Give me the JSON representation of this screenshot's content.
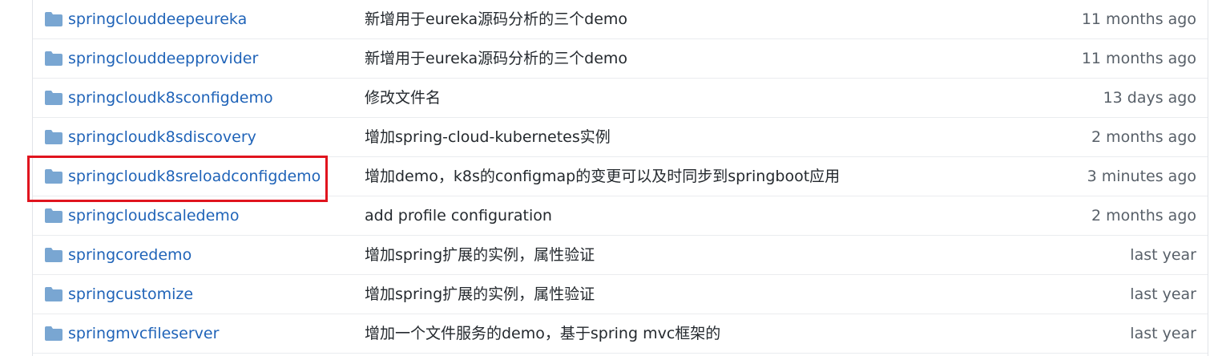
{
  "colors": {
    "link": "#1f63b8",
    "folder_icon": "#79a6d2",
    "highlight": "#e0141e",
    "age_text": "#586069"
  },
  "rows": [
    {
      "name": "springclouddeepeureka",
      "message": "新增用于eureka源码分析的三个demo",
      "age": "11 months ago",
      "icon": "folder-icon"
    },
    {
      "name": "springclouddeepprovider",
      "message": "新增用于eureka源码分析的三个demo",
      "age": "11 months ago",
      "icon": "folder-icon"
    },
    {
      "name": "springcloudk8sconfigdemo",
      "message": "修改文件名",
      "age": "13 days ago",
      "icon": "folder-icon"
    },
    {
      "name": "springcloudk8sdiscovery",
      "message": "增加spring-cloud-kubernetes实例",
      "age": "2 months ago",
      "icon": "folder-icon"
    },
    {
      "name": "springcloudk8sreloadconfigdemo",
      "message": "增加demo，k8s的configmap的变更可以及时同步到springboot应用",
      "age": "3 minutes ago",
      "icon": "folder-icon",
      "highlighted": true
    },
    {
      "name": "springcloudscaledemo",
      "message": "add profile configuration",
      "age": "2 months ago",
      "icon": "folder-icon"
    },
    {
      "name": "springcoredemo",
      "message": "增加spring扩展的实例，属性验证",
      "age": "last year",
      "icon": "folder-icon"
    },
    {
      "name": "springcustomize",
      "message": "增加spring扩展的实例，属性验证",
      "age": "last year",
      "icon": "folder-icon"
    },
    {
      "name": "springmvcfileserver",
      "message": "增加一个文件服务的demo，基于spring mvc框架的",
      "age": "last year",
      "icon": "folder-icon"
    }
  ]
}
